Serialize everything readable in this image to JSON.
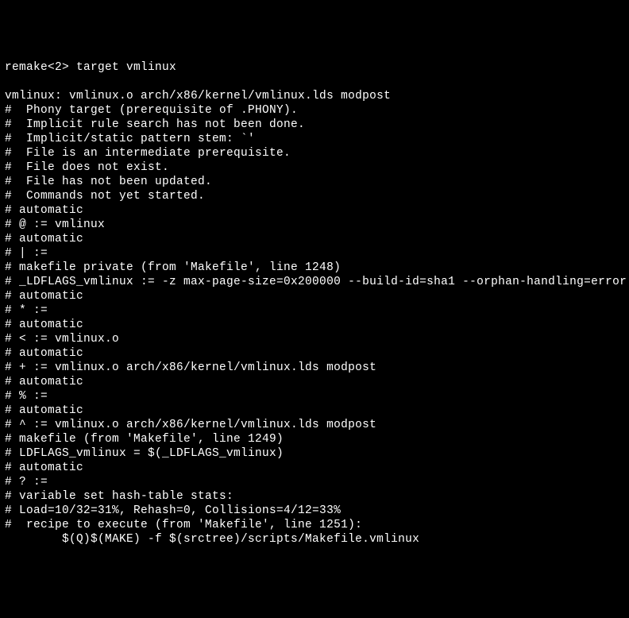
{
  "terminal": {
    "lines": [
      "remake<2> target vmlinux",
      "",
      "vmlinux: vmlinux.o arch/x86/kernel/vmlinux.lds modpost",
      "#  Phony target (prerequisite of .PHONY).",
      "#  Implicit rule search has not been done.",
      "#  Implicit/static pattern stem: `'",
      "#  File is an intermediate prerequisite.",
      "#  File does not exist.",
      "#  File has not been updated.",
      "#  Commands not yet started.",
      "# automatic",
      "# @ := vmlinux",
      "# automatic",
      "# | :=",
      "# makefile private (from 'Makefile', line 1248)",
      "# _LDFLAGS_vmlinux := -z max-page-size=0x200000 --build-id=sha1 --orphan-handling=error",
      "# automatic",
      "# * :=",
      "# automatic",
      "# < := vmlinux.o",
      "# automatic",
      "# + := vmlinux.o arch/x86/kernel/vmlinux.lds modpost",
      "# automatic",
      "# % :=",
      "# automatic",
      "# ^ := vmlinux.o arch/x86/kernel/vmlinux.lds modpost",
      "# makefile (from 'Makefile', line 1249)",
      "# LDFLAGS_vmlinux = $(_LDFLAGS_vmlinux)",
      "# automatic",
      "# ? :=",
      "# variable set hash-table stats:",
      "# Load=10/32=31%, Rehash=0, Collisions=4/12=33%",
      "#  recipe to execute (from 'Makefile', line 1251):",
      "        $(Q)$(MAKE) -f $(srctree)/scripts/Makefile.vmlinux"
    ]
  }
}
